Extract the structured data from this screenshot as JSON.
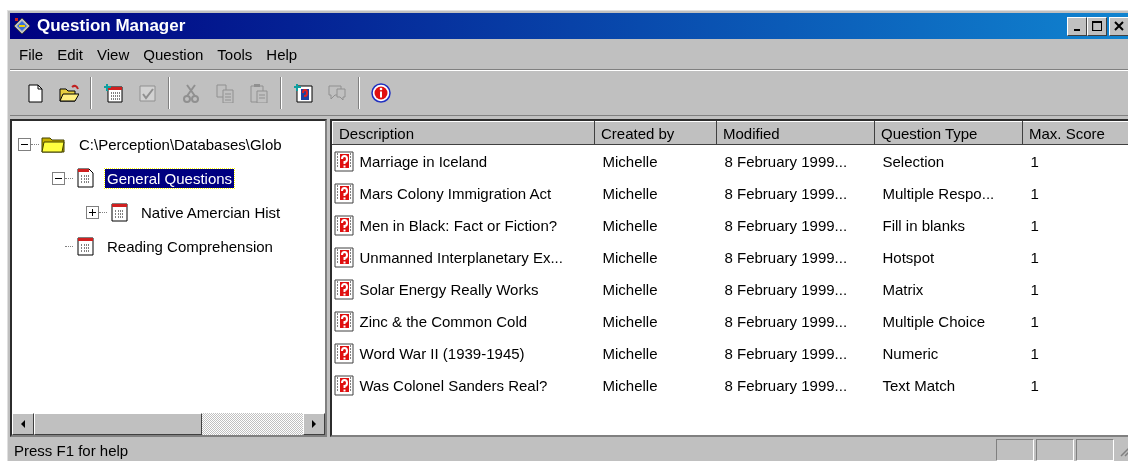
{
  "window": {
    "title": "Question Manager"
  },
  "menu": [
    "File",
    "Edit",
    "View",
    "Question",
    "Tools",
    "Help"
  ],
  "toolbar": [
    {
      "kind": "new",
      "disabled": false
    },
    {
      "kind": "open",
      "disabled": false
    },
    {
      "kind": "separator"
    },
    {
      "kind": "new-list",
      "disabled": false
    },
    {
      "kind": "spelling",
      "disabled": true
    },
    {
      "kind": "separator"
    },
    {
      "kind": "cut",
      "disabled": true
    },
    {
      "kind": "copy",
      "disabled": true
    },
    {
      "kind": "paste",
      "disabled": true
    },
    {
      "kind": "separator"
    },
    {
      "kind": "new-question",
      "disabled": false
    },
    {
      "kind": "preview",
      "disabled": true
    },
    {
      "kind": "separator"
    },
    {
      "kind": "info",
      "disabled": false
    }
  ],
  "tree": [
    {
      "label": "C:\\Perception\\Databases\\Glob",
      "kind": "folder",
      "expanded": true,
      "selected": false,
      "children": [
        {
          "label": "General Questions",
          "kind": "document",
          "expanded": true,
          "selected": true,
          "children": [
            {
              "label": "Native Amercian Hist",
              "kind": "list",
              "expanded": false,
              "selected": false
            }
          ]
        },
        {
          "label": "Reading Comprehension",
          "kind": "list",
          "selected": false
        }
      ]
    }
  ],
  "table": {
    "columns": [
      "Description",
      "Created by",
      "Modified",
      "Question Type",
      "Max. Score"
    ],
    "rows": [
      [
        "Marriage in Iceland",
        "Michelle",
        "8 February 1999...",
        "Selection",
        "1"
      ],
      [
        "Mars Colony Immigration Act",
        "Michelle",
        "8 February 1999...",
        "Multiple Respo...",
        "1"
      ],
      [
        "Men in Black: Fact or Fiction?",
        "Michelle",
        "8 February 1999...",
        "Fill in blanks",
        "1"
      ],
      [
        "Unmanned Interplanetary Ex...",
        "Michelle",
        "8 February 1999...",
        "Hotspot",
        "1"
      ],
      [
        "Solar Energy Really Works",
        "Michelle",
        "8 February 1999...",
        "Matrix",
        "1"
      ],
      [
        "Zinc & the Common Cold",
        "Michelle",
        "8 February 1999...",
        "Multiple Choice",
        "1"
      ],
      [
        "Word War II (1939-1945)",
        "Michelle",
        "8 February 1999...",
        "Numeric",
        "1"
      ],
      [
        "Was Colonel Sanders Real?",
        "Michelle",
        "8 February 1999...",
        "Text Match",
        "1"
      ]
    ]
  },
  "status_bar": {
    "text": "Press F1 for help"
  }
}
